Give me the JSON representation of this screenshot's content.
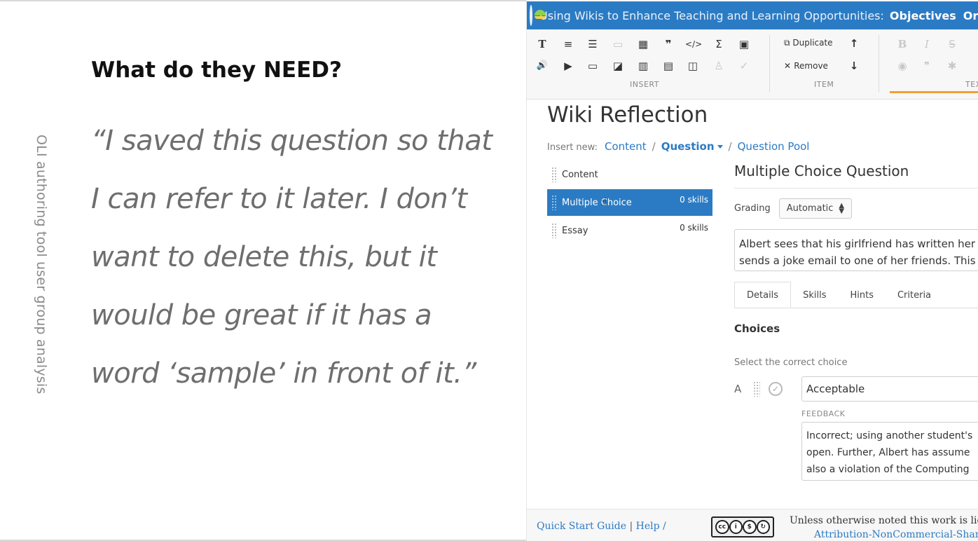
{
  "slide": {
    "vertical_caption": "OLI authoring tool user group analysis",
    "title": "What do they NEED?",
    "quote_lines": [
      "“I saved this question so that",
      "I can refer to it later. I don’t",
      "want to delete this, but it",
      "would be great if it has a",
      "word ‘sample’ in front of it.”"
    ]
  },
  "app": {
    "topbar": {
      "course_title": "Using Wikis to Enhance Teaching and Learning Opportunities:",
      "nav_objectives": "Objectives",
      "nav_organize": "Org"
    },
    "toolbar": {
      "insert_icons_row1": [
        "T",
        "≡",
        "☰",
        "▭",
        "▦",
        "❞",
        "</>",
        "Σ",
        "▣"
      ],
      "insert_icons_row2": [
        "🔊",
        "▶",
        "▭",
        "◪",
        "▥",
        "▤",
        "◫",
        "♙",
        "✓"
      ],
      "insert_label": "INSERT",
      "duplicate_label": "Duplicate",
      "remove_label": "Remove",
      "move_up": "↑",
      "move_down": "↓",
      "item_label": "ITEM",
      "text_icons_row1": [
        "B",
        "I",
        "S"
      ],
      "text_icons_row2": [
        "◉",
        "❞",
        "✱"
      ],
      "text_label": "TEX"
    },
    "page_heading": "Wiki Reflection",
    "insert_new": {
      "label": "Insert new:",
      "content": "Content",
      "sep": "/",
      "question": "Question",
      "pool": "Question Pool"
    },
    "items": [
      {
        "label": "Content",
        "skills": ""
      },
      {
        "label": "Multiple Choice",
        "skills": "0 skills"
      },
      {
        "label": "Essay",
        "skills": "0 skills"
      }
    ],
    "question": {
      "title": "Multiple Choice Question",
      "grading_label": "Grading",
      "grading_value": "Automatic",
      "body_line1": "Albert sees that his girlfriend has written her p",
      "body_line2": "sends a joke email to one of her friends. This a",
      "tabs": [
        "Details",
        "Skills",
        "Hints",
        "Criteria"
      ],
      "choices_heading": "Choices",
      "select_correct": "Select the correct choice",
      "choice_letter": "A",
      "choice_value": "Acceptable",
      "feedback_label": "FEEDBACK",
      "feedback_line1": "Incorrect; using another student's",
      "feedback_line2": "open. Further, Albert has assume",
      "feedback_line3": "also a violation of the Computing"
    },
    "footer": {
      "quick_start": "Quick Start Guide",
      "pipe": "|",
      "help": "Help /",
      "license_text": "Unless otherwise noted this work is licen",
      "license_link": "Attribution-NonCommercial-ShareA"
    }
  }
}
